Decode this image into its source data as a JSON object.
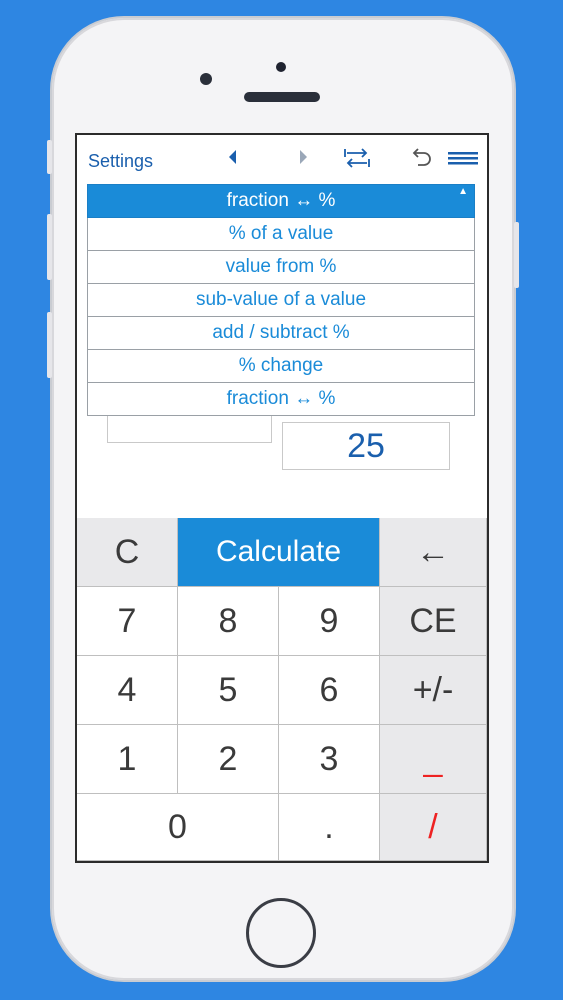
{
  "toolbar": {
    "settings_label": "Settings",
    "icons": [
      "prev-arrow-icon",
      "next-arrow-icon",
      "swap-icon",
      "undo-icon",
      "menu-icon"
    ]
  },
  "dropdown": {
    "selected": "fraction ↔ %",
    "options": [
      "% of a value",
      "value from %",
      "sub-value of a value",
      "add / subtract %",
      "% change",
      "fraction ↔ %"
    ]
  },
  "fields": {
    "left_value": "",
    "right_value": "25"
  },
  "keypad": {
    "clear": "C",
    "calculate": "Calculate",
    "backspace": "←",
    "seven": "7",
    "eight": "8",
    "nine": "9",
    "clear_entry": "CE",
    "four": "4",
    "five": "5",
    "six": "6",
    "sign": "+/-",
    "one": "1",
    "two": "2",
    "three": "3",
    "fraction_bar": "_",
    "zero": "0",
    "decimal": ".",
    "divide": "/"
  },
  "colors": {
    "background": "#2e86e2",
    "accent": "#1a8bd8",
    "text_blue": "#1a5fad",
    "red_keys": "#ee2222"
  }
}
